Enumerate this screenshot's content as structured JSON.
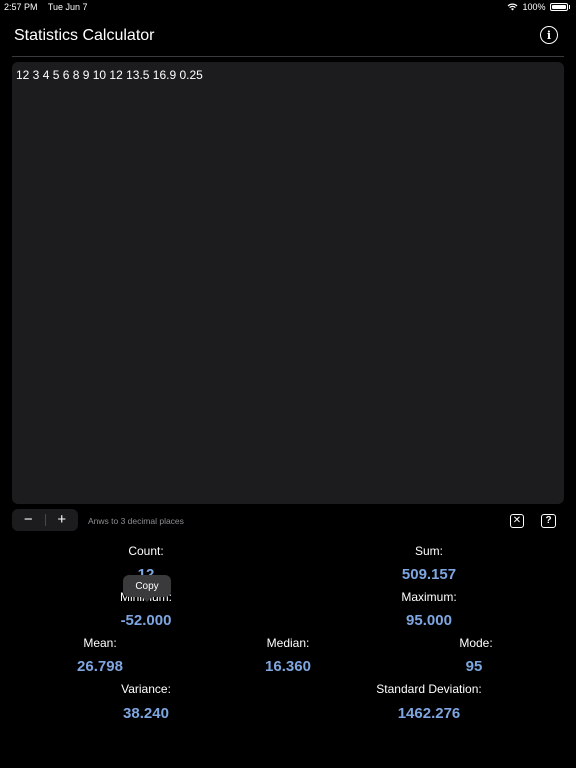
{
  "status_bar": {
    "time": "2:57 PM",
    "date": "Tue Jun 7",
    "battery": "100%"
  },
  "header": {
    "title": "Statistics Calculator"
  },
  "editor": {
    "text": "12 3 4 5 6 8 9 10 12 13.5 16.9 0.25"
  },
  "toolbar": {
    "minus": "−",
    "plus": "+",
    "precision_note": "Anws to 3 decimal places"
  },
  "tooltip": {
    "label": "Copy"
  },
  "stats": {
    "count_label": "Count:",
    "count_value": "12",
    "sum_label": "Sum:",
    "sum_value": "509.157",
    "minimum_label": "Minimum:",
    "minimum_value": "-52.000",
    "maximum_label": "Maximum:",
    "maximum_value": "95.000",
    "mean_label": "Mean:",
    "mean_value": "26.798",
    "median_label": "Median:",
    "median_value": "16.360",
    "mode_label": "Mode:",
    "mode_value": "95",
    "variance_label": "Variance:",
    "variance_value": "38.240",
    "stddev_label": "Standard Deviation:",
    "stddev_value": "1462.276"
  },
  "colors": {
    "value_blue": "#7ea6e0",
    "editor_bg": "#1c1c1e"
  }
}
